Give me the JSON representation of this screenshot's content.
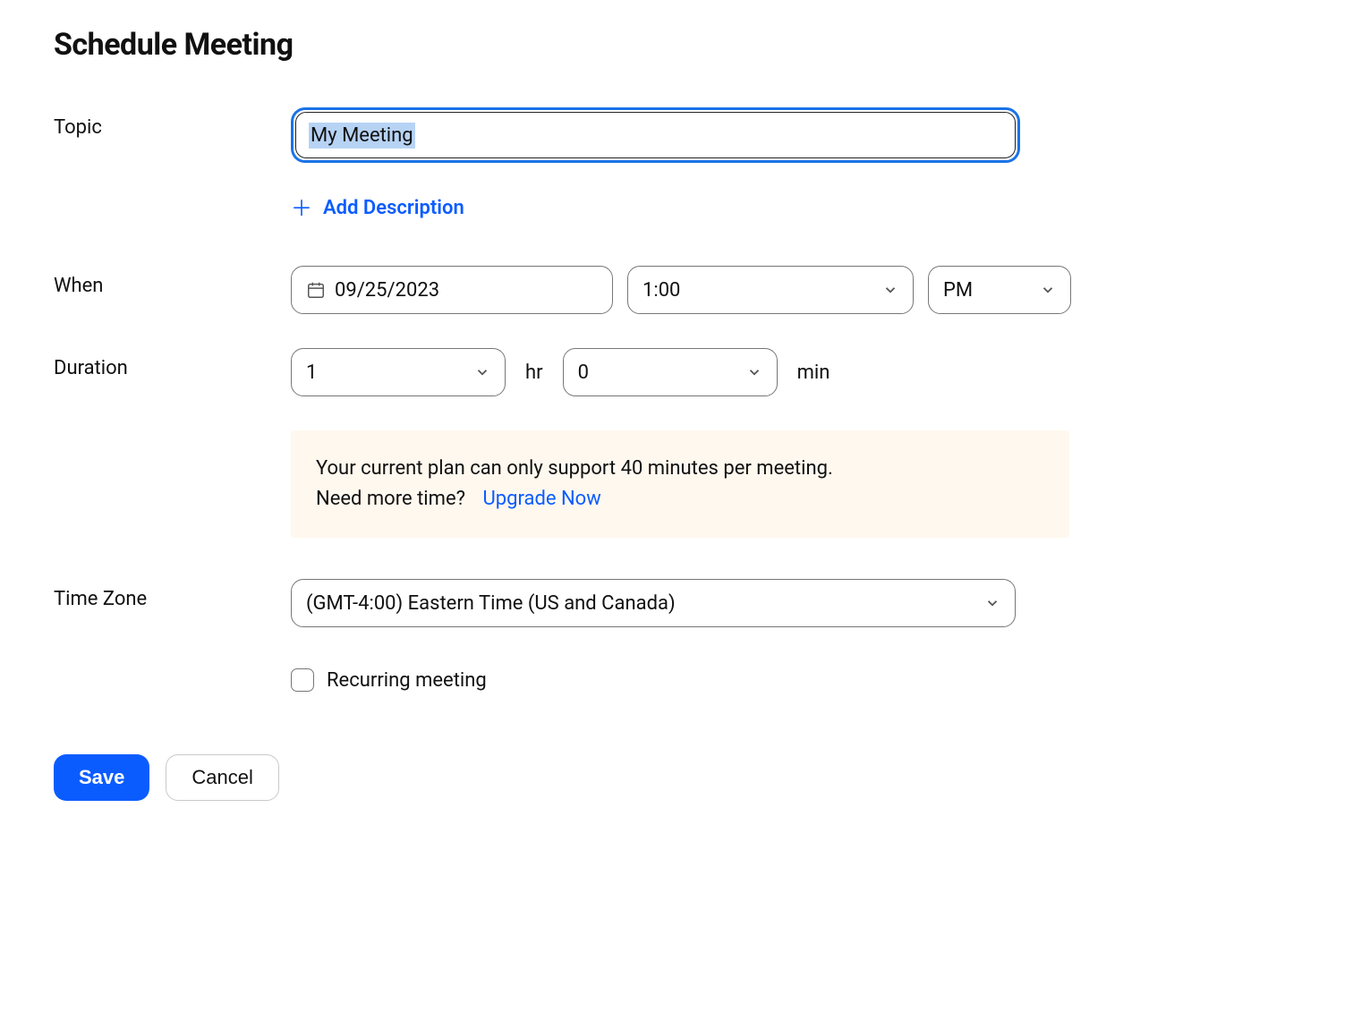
{
  "page_title": "Schedule Meeting",
  "labels": {
    "topic": "Topic",
    "when": "When",
    "duration": "Duration",
    "timezone": "Time Zone"
  },
  "topic": {
    "value": "My Meeting"
  },
  "add_description": "Add Description",
  "when": {
    "date": "09/25/2023",
    "time": "1:00",
    "ampm": "PM"
  },
  "duration": {
    "hours": "1",
    "hr_label": "hr",
    "minutes": "0",
    "min_label": "min"
  },
  "notice": {
    "line1": "Your current plan can only support 40 minutes per meeting.",
    "line2_prefix": "Need more time?",
    "upgrade": "Upgrade Now"
  },
  "timezone": {
    "value": "(GMT-4:00) Eastern Time (US and Canada)"
  },
  "recurring": {
    "label": "Recurring meeting",
    "checked": false
  },
  "buttons": {
    "save": "Save",
    "cancel": "Cancel"
  }
}
